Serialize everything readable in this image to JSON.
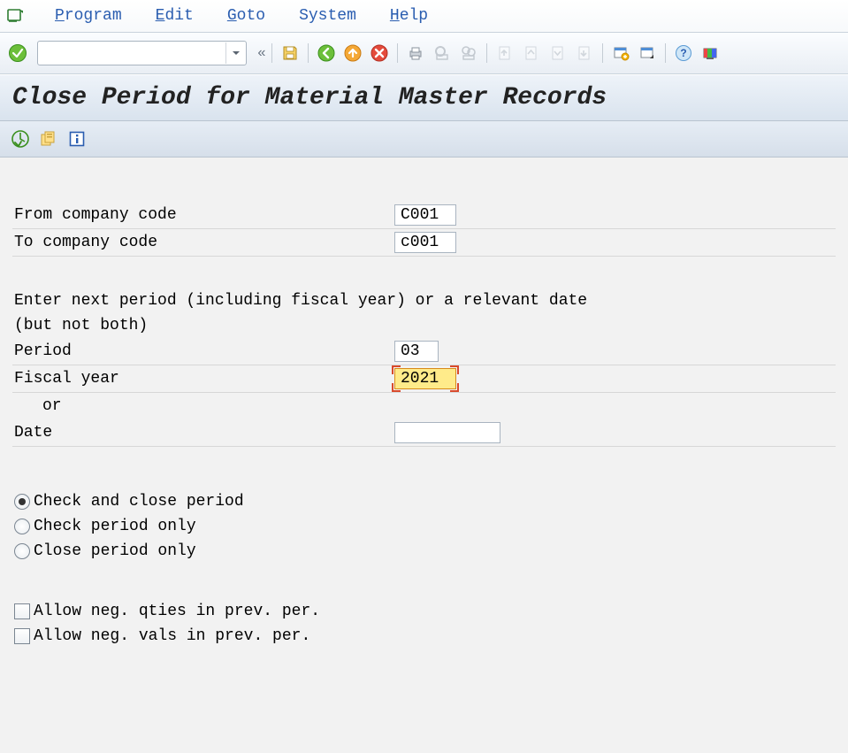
{
  "menu": {
    "program": "Program",
    "edit": "Edit",
    "goto": "Goto",
    "system": "System",
    "help": "Help"
  },
  "command_field": {
    "value": ""
  },
  "title": "Close Period for Material Master Records",
  "fields": {
    "from_cc_label": "From company code",
    "from_cc_value": "C001",
    "to_cc_label": "To company code",
    "to_cc_value": "c001",
    "instruction_line1": "Enter next period (including fiscal year) or a relevant date",
    "instruction_line2": "(but not both)",
    "period_label": "Period",
    "period_value": "03",
    "fiscal_year_label": "Fiscal year",
    "fiscal_year_value": "2021",
    "or_label": "or",
    "date_label": "Date",
    "date_value": ""
  },
  "radios": {
    "check_close": "Check and close period",
    "check_only": "Check period only",
    "close_only": "Close period only",
    "selected": "check_close"
  },
  "checkboxes": {
    "neg_qty": "Allow neg. qties in prev. per.",
    "neg_val": "Allow neg. vals in prev. per."
  }
}
